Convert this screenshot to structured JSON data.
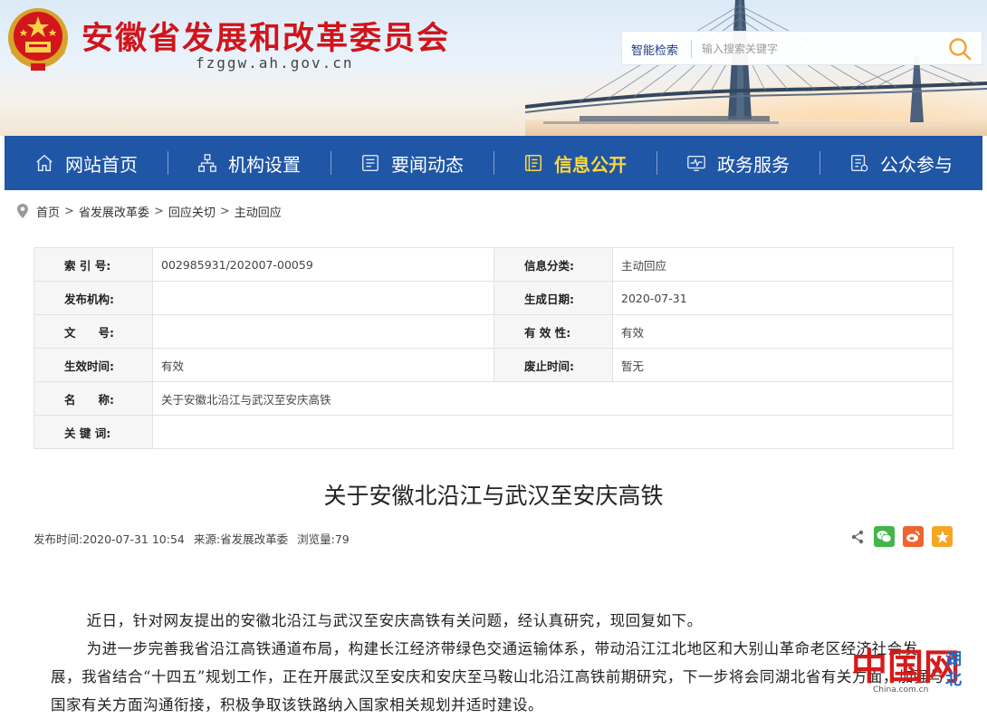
{
  "header": {
    "site_title": "安徽省发展和改革委员会",
    "site_domain": "fzggw.ah.gov.cn",
    "search": {
      "label": "智能检索",
      "placeholder": "输入搜索关键字"
    }
  },
  "nav": {
    "items": [
      {
        "label": "网站首页",
        "icon": "home-icon"
      },
      {
        "label": "机构设置",
        "icon": "org-chart-icon"
      },
      {
        "label": "要闻动态",
        "icon": "news-icon"
      },
      {
        "label": "信息公开",
        "icon": "info-disclosure-icon",
        "active": true
      },
      {
        "label": "政务服务",
        "icon": "service-monitor-icon"
      },
      {
        "label": "公众参与",
        "icon": "participation-form-icon"
      }
    ]
  },
  "breadcrumb": [
    "首页",
    "省发展改革委",
    "回应关切",
    "主动回应"
  ],
  "breadcrumb_separator": ">",
  "info_table": {
    "index_label": "索 引 号:",
    "index_value": "002985931/202007-00059",
    "category_label": "信息分类:",
    "category_value": "主动回应",
    "publisher_label": "发布机构:",
    "publisher_value": "",
    "created_label": "生成日期:",
    "created_value": "2020-07-31",
    "docno_label": "文　　号:",
    "docno_value": "",
    "validity_label": "有 效 性:",
    "validity_value": "有效",
    "effective_label": "生效时间:",
    "effective_value": "有效",
    "repeal_label": "废止时间:",
    "repeal_value": "暂无",
    "name_label": "名　　称:",
    "name_value": "关于安徽北沿江与武汉至安庆高铁",
    "keywords_label": "关 键 词:",
    "keywords_value": ""
  },
  "article": {
    "title": "关于安徽北沿江与武汉至安庆高铁",
    "publish_time_label": "发布时间:",
    "publish_time": "2020-07-31 10:54",
    "source_label": "来源:",
    "source": "省发展改革委",
    "views_label": "浏览量:",
    "views": "79",
    "paragraphs": [
      "近日，针对网友提出的安徽北沿江与武汉至安庆高铁有关问题，经认真研究，现回复如下。",
      "为进一步完善我省沿江高铁通道布局，构建长江经济带绿色交通运输体系，带动沿江江北地区和大别山革命老区经济社会发展，我省结合“十四五”规划工作，正在开展武汉至安庆和安庆至马鞍山北沿江高铁前期研究，下一步将会同湖北省有关方面，加强与国家有关方面沟通衔接，积极争取该铁路纳入国家相关规划并适时建设。"
    ]
  },
  "watermark": {
    "brand": "中国网",
    "domain": "China.com.cn",
    "region": "湖北"
  },
  "colors": {
    "title_red": "#d1141b",
    "nav_blue": "#1f56a6",
    "nav_active": "#ffd83a",
    "wechat_green": "#44b549",
    "weibo_orange": "#f0642e",
    "qzone_orange": "#f5a623"
  }
}
